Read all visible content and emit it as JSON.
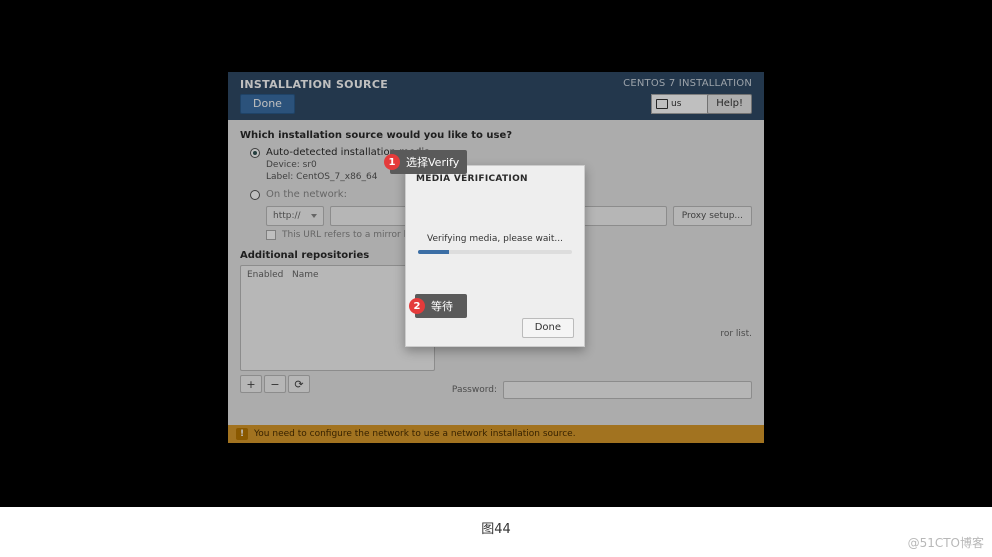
{
  "header": {
    "title": "INSTALLATION SOURCE",
    "done": "Done",
    "product": "CENTOS 7 INSTALLATION",
    "keyboard": "us",
    "help": "Help!"
  },
  "source": {
    "question": "Which installation source would you like to use?",
    "auto_label": "Auto-detected installation media :",
    "device": "Device: sr0",
    "label": "Label: CentOS_7_x86_64",
    "on_network": "On the network:",
    "protocol": "http://",
    "proxy": "Proxy setup...",
    "mirror": "This URL refers to a mirror list."
  },
  "repos": {
    "title": "Additional repositories",
    "col_enabled": "Enabled",
    "col_name": "Name",
    "add": "+",
    "remove": "−",
    "reload": "⟳",
    "right_note": "ror list.",
    "password": "Password:"
  },
  "warning": "You need to configure the network to use a network installation source.",
  "modal": {
    "title": "MEDIA VERIFICATION",
    "text": "Verifying media, please wait...",
    "done": "Done"
  },
  "annotations": {
    "a1_num": "1",
    "a1_text": "选择Verify",
    "a2_num": "2",
    "a2_text": "等待"
  },
  "caption": "图44",
  "watermark": "@51CTO博客"
}
